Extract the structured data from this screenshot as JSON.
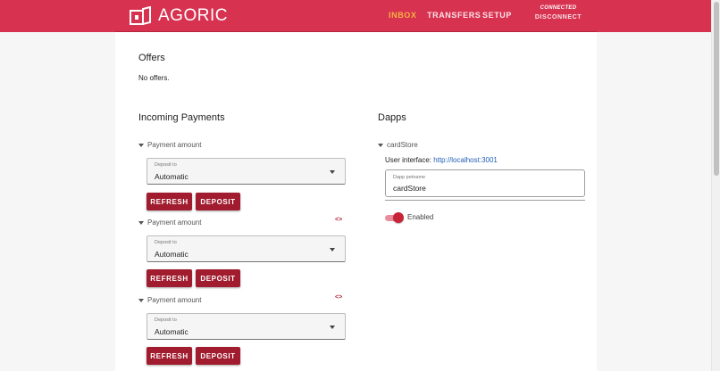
{
  "header": {
    "logo_text": "AGORIC",
    "nav": [
      {
        "label": "INBOX",
        "active": true
      },
      {
        "label": "TRANSFERS",
        "active": false
      },
      {
        "label": "SETUP",
        "active": false
      }
    ],
    "connection_status": "CONNECTED",
    "disconnect_label": "DISCONNECT"
  },
  "offers": {
    "title": "Offers",
    "empty_text": "No offers."
  },
  "incoming_payments": {
    "title": "Incoming Payments",
    "items": [
      {
        "summary": "Payment amount",
        "deposit_label": "Deposit to",
        "deposit_value": "Automatic",
        "refresh_label": "REFRESH",
        "deposit_button": "DEPOSIT"
      },
      {
        "summary": "Payment amount",
        "deposit_label": "Deposit to",
        "deposit_value": "Automatic",
        "refresh_label": "REFRESH",
        "deposit_button": "DEPOSIT",
        "code_icon": "<>"
      },
      {
        "summary": "Payment amount",
        "deposit_label": "Deposit to",
        "deposit_value": "Automatic",
        "refresh_label": "REFRESH",
        "deposit_button": "DEPOSIT",
        "code_icon": "<>"
      }
    ]
  },
  "dapps": {
    "title": "Dapps",
    "items": [
      {
        "name": "cardStore",
        "ui_label": "User interface:",
        "ui_url": "http://localhost:3001",
        "petname_label": "Dapp petname",
        "petname_value": "cardStore",
        "enabled_label": "Enabled",
        "enabled": true
      }
    ]
  },
  "colors": {
    "brand": "#d73250",
    "nav_active": "#f5b240",
    "button": "#a01c2e",
    "link": "#1f5eb5"
  }
}
